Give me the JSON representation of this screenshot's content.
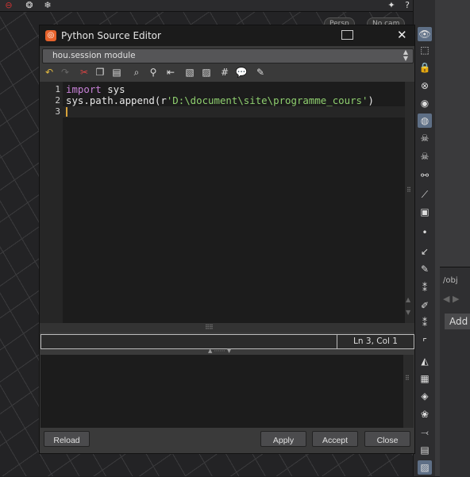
{
  "editor": {
    "title": "Python Source Editor",
    "module_select": "hou.session module",
    "code_lines": [
      {
        "num": "1",
        "keyword": "import",
        "rest": " sys"
      },
      {
        "num": "2",
        "prefix": "sys.path.append(r",
        "string": "'D:\\document\\site\\programme_cours'",
        "suffix": ")"
      },
      {
        "num": "3"
      }
    ],
    "status_position": "Ln 3, Col 1",
    "buttons": {
      "reload": "Reload",
      "apply": "Apply",
      "accept": "Accept",
      "close": "Close"
    }
  },
  "network": {
    "path": "/obj",
    "add_label": "Add"
  },
  "topbar": {
    "pill_left": "Persp",
    "pill_right": "No cam"
  },
  "icons": {
    "close": "close-icon",
    "undock": "undock-icon",
    "logo": "houdini-logo-icon"
  },
  "colors": {
    "accent_logo": "#e6622b",
    "keyword": "#c882d8",
    "string": "#8fcf6f",
    "cursor": "#d8a33a"
  }
}
